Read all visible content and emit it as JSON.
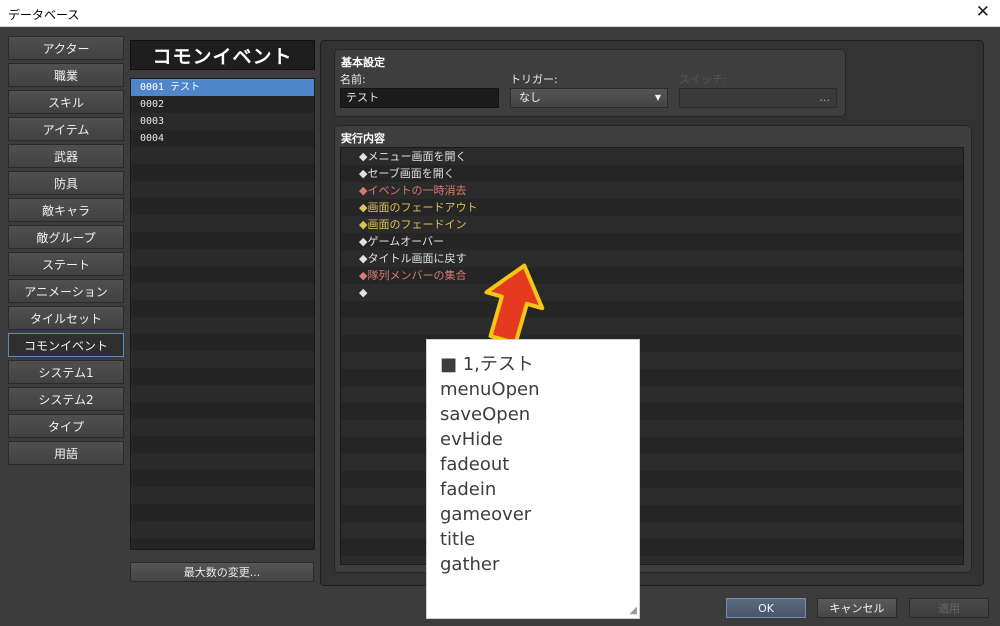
{
  "window": {
    "title": "データベース",
    "close_glyph": "✕"
  },
  "categories": [
    "アクター",
    "職業",
    "スキル",
    "アイテム",
    "武器",
    "防具",
    "敵キャラ",
    "敵グループ",
    "ステート",
    "アニメーション",
    "タイルセット",
    "コモンイベント",
    "システム1",
    "システム2",
    "タイプ",
    "用語"
  ],
  "active_category": "コモンイベント",
  "common_events": {
    "title": "コモンイベント",
    "items": [
      "0001 テスト",
      "0002",
      "0003",
      "0004"
    ],
    "selected_index": 0,
    "change_max_button": "最大数の変更..."
  },
  "basic_settings": {
    "group_title": "基本設定",
    "name_label": "名前:",
    "name_value": "テスト",
    "trigger_label": "トリガー:",
    "trigger_value": "なし",
    "switch_label": "スイッチ:",
    "switch_button": "..."
  },
  "contents": {
    "group_title": "実行内容",
    "commands": [
      {
        "text": "◆メニュー画面を開く",
        "color": "white"
      },
      {
        "text": "◆セーブ画面を開く",
        "color": "white"
      },
      {
        "text": "◆イベントの一時消去",
        "color": "red"
      },
      {
        "text": "◆画面のフェードアウト",
        "color": "yellow"
      },
      {
        "text": "◆画面のフェードイン",
        "color": "yellow"
      },
      {
        "text": "◆ゲームオーバー",
        "color": "white"
      },
      {
        "text": "◆タイトル画面に戻す",
        "color": "white"
      },
      {
        "text": "◆隊列メンバーの集合",
        "color": "red"
      },
      {
        "text": "◆",
        "color": "white"
      }
    ]
  },
  "note_overlay": {
    "lines": [
      "■ 1,テスト",
      "menuOpen",
      "saveOpen",
      "evHide",
      "fadeout",
      "fadein",
      "gameover",
      "title",
      "gather"
    ]
  },
  "footer": {
    "ok": "OK",
    "cancel": "キャンセル",
    "apply": "適用"
  },
  "colors": {
    "accent_blue": "#4f85c9",
    "arrow_red": "#e53a1f",
    "arrow_yellow": "#f5c518",
    "cmd_red": "#d77c70",
    "cmd_yellow": "#dcc25c"
  }
}
